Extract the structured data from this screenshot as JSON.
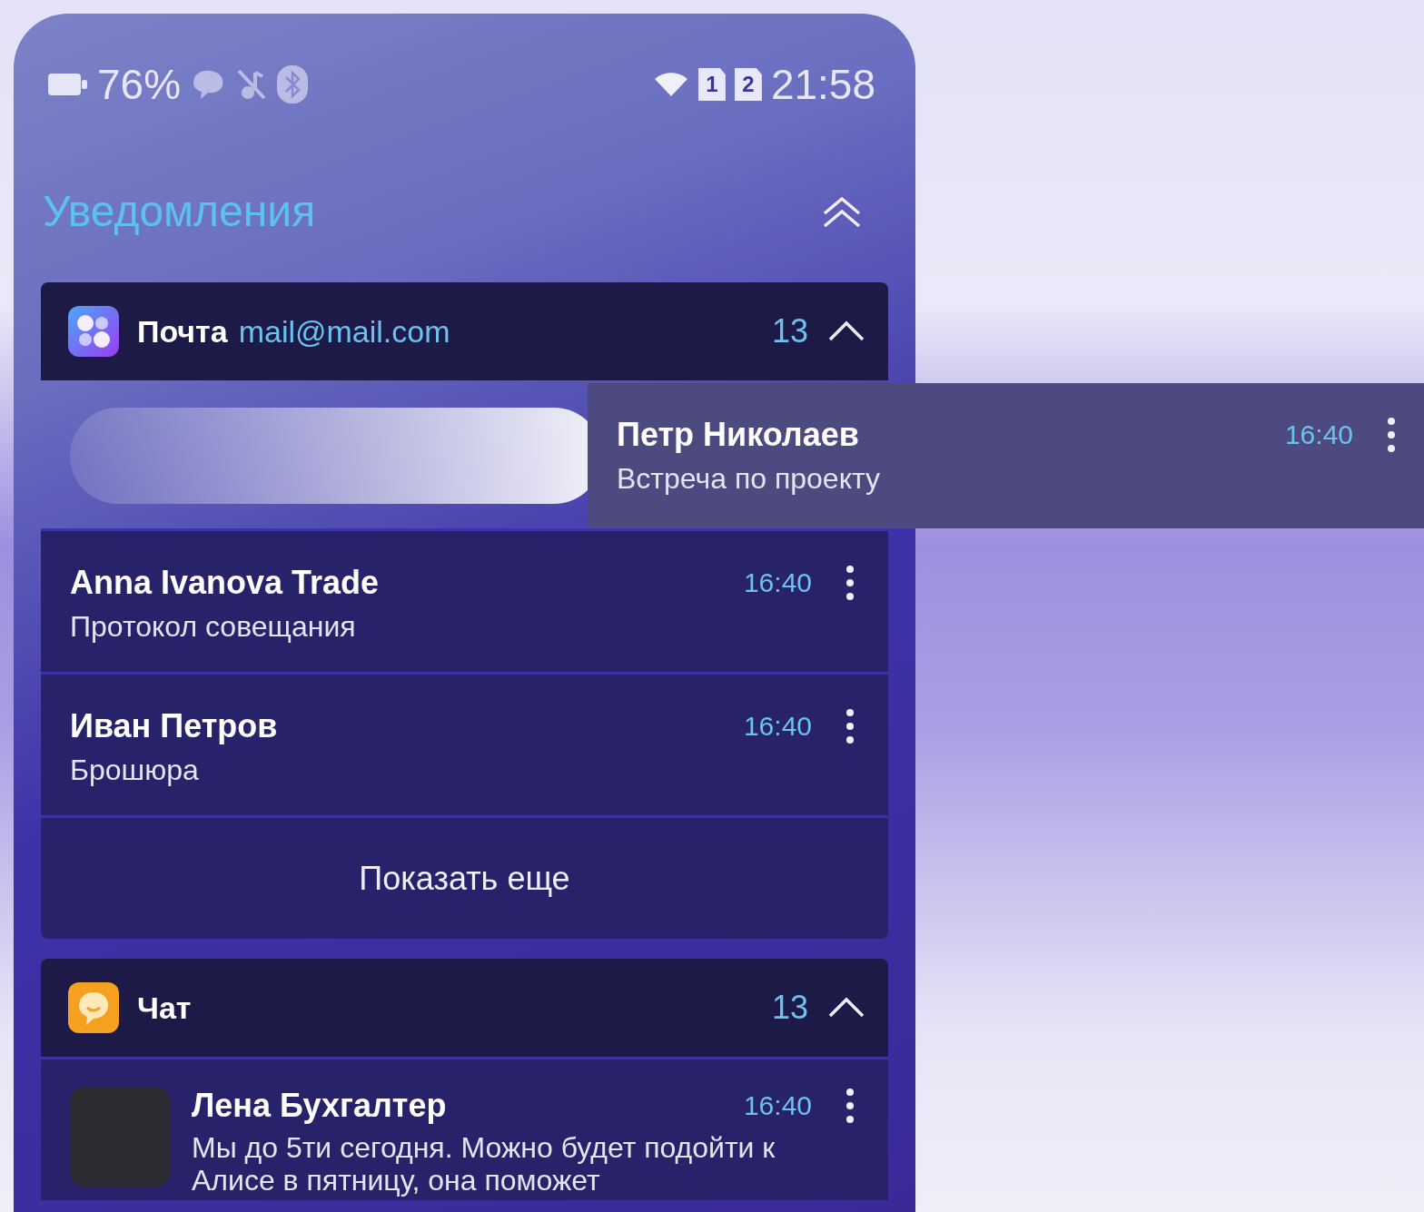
{
  "status_bar": {
    "battery": "76%",
    "sim_slots": [
      "1",
      "2"
    ],
    "time": "21:58"
  },
  "title": "Уведомления",
  "groups": [
    {
      "kind": "mail",
      "app": "Почта",
      "account": "mail@mail.com",
      "count": "13",
      "expanded": true,
      "items": [
        {
          "sender": "Петр Николаев",
          "subject": "Встреча по проекту",
          "time": "16:40",
          "swiped": true,
          "avatar": false
        },
        {
          "sender": "Anna Ivanova Trade",
          "subject": "Протокол совещания",
          "time": "16:40",
          "swiped": false,
          "avatar": false
        },
        {
          "sender": "Иван Петров",
          "subject": "Брошюра",
          "time": "16:40",
          "swiped": false,
          "avatar": false
        }
      ],
      "show_more": "Показать еще"
    },
    {
      "kind": "chat",
      "app": "Чат",
      "count": "13",
      "expanded": true,
      "items": [
        {
          "sender": "Лена Бухгалтер",
          "subject": "Мы до 5ти сегодня. Можно будет подойти к Алисе в пятницу, она поможет",
          "time": "16:40",
          "swiped": false,
          "avatar": true
        }
      ]
    }
  ]
}
